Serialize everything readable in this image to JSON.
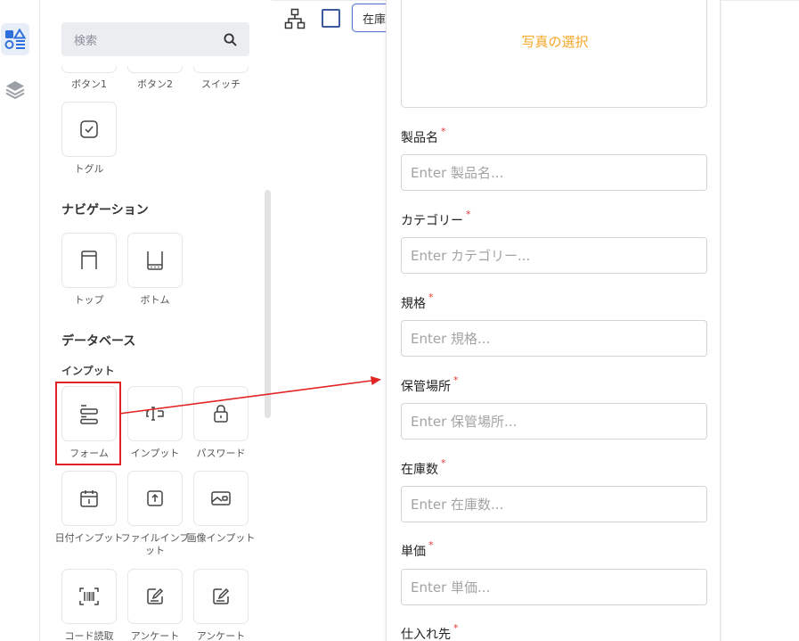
{
  "panel": {
    "search_placeholder": "検索",
    "top_row": [
      "ボタン1",
      "ボタン2",
      "スイッチ"
    ],
    "toggle_label": "トグル",
    "nav_section": "ナビゲーション",
    "nav_items": [
      "トップ",
      "ボトム"
    ],
    "db_section": "データベース",
    "input_subsection": "インプット",
    "input_row1": [
      "フォーム",
      "インプット",
      "パスワード"
    ],
    "input_row2": [
      "日付インプット",
      "ファイルインプット",
      "画像インプット"
    ],
    "input_row3": [
      "コード読取",
      "アンケート",
      "アンケート"
    ]
  },
  "toolbar": {
    "screen_select": "在庫更新"
  },
  "form": {
    "photo_select": "写真の選択",
    "required_mark": "*",
    "fields": [
      {
        "label": "製品名",
        "placeholder": "Enter 製品名..."
      },
      {
        "label": "カテゴリー",
        "placeholder": "Enter カテゴリー..."
      },
      {
        "label": "規格",
        "placeholder": "Enter 規格..."
      },
      {
        "label": "保管場所",
        "placeholder": "Enter 保管場所..."
      },
      {
        "label": "在庫数",
        "placeholder": "Enter 在庫数..."
      },
      {
        "label": "単価",
        "placeholder": "Enter 単価..."
      },
      {
        "label": "仕入れ先",
        "placeholder": ""
      }
    ]
  },
  "colors": {
    "accent": "#2f6fdb",
    "annotation": "#e02424",
    "photo_link": "#f5a623",
    "required": "#e53935"
  }
}
